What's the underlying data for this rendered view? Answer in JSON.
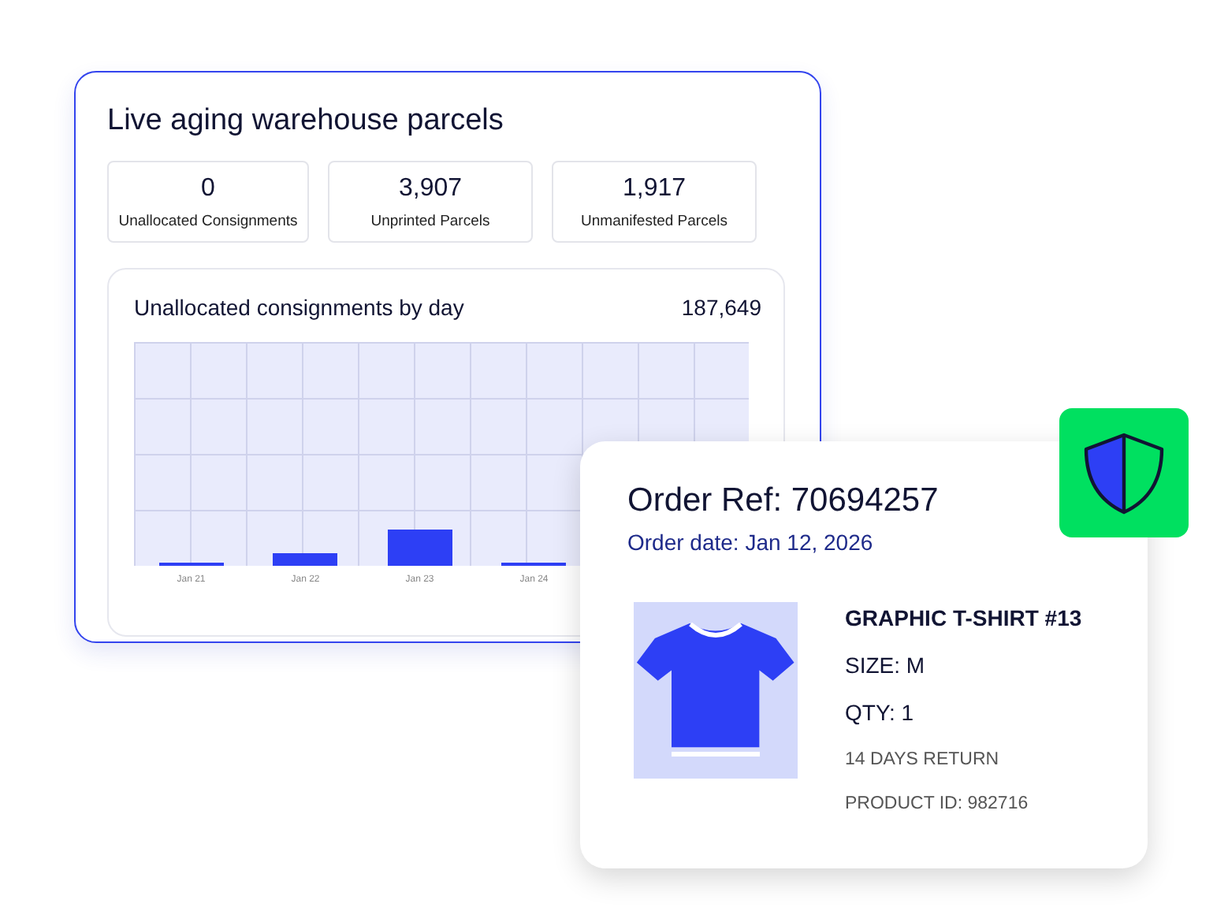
{
  "dashboard": {
    "title": "Live aging warehouse parcels",
    "stats": [
      {
        "value": "0",
        "label": "Unallocated Consignments"
      },
      {
        "value": "3,907",
        "label": "Unprinted Parcels"
      },
      {
        "value": "1,917",
        "label": "Unmanifested Parcels"
      }
    ],
    "chart_panel": {
      "title": "Unallocated consignments by day",
      "total": "187,649",
      "day_labels": [
        "Jan 21",
        "Jan 22",
        "Jan 23",
        "Jan 24"
      ]
    }
  },
  "order": {
    "ref": "Order Ref: 70694257",
    "date": "Order date: Jan 12, 2026",
    "product": {
      "name": "GRAPHIC T-SHIRT #13",
      "size": "SIZE: M",
      "qty": "QTY: 1",
      "returns": "14 DAYS RETURN",
      "product_id": "PRODUCT ID: 982716"
    }
  }
}
